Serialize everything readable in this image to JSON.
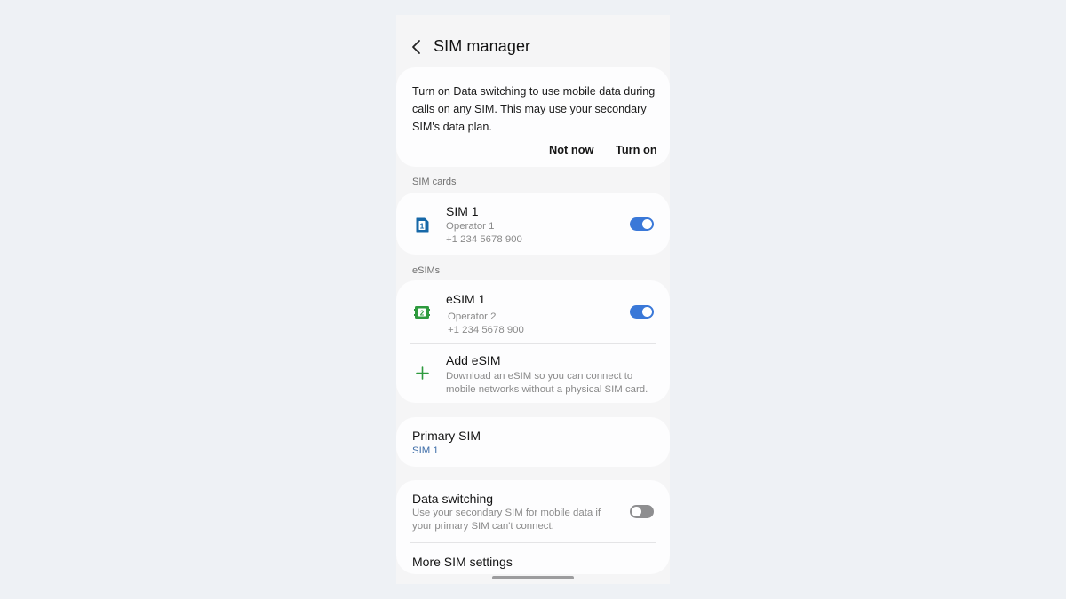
{
  "app": {
    "title": "SIM manager"
  },
  "notice": {
    "text": "Turn on Data switching to use mobile data during calls on any SIM. This may use your secondary SIM's data plan.",
    "not_now": "Not now",
    "turn_on": "Turn on"
  },
  "sim_cards": {
    "section_label": "SIM cards",
    "items": [
      {
        "title": "SIM 1",
        "operator": "Operator 1",
        "number": "+1 234 5678 900",
        "icon": "sim-card-1-icon",
        "icon_label": "1",
        "enabled": true,
        "icon_color": "#1668a8"
      }
    ]
  },
  "esims": {
    "section_label": "eSIMs",
    "items": [
      {
        "title": "eSIM 1",
        "operator": "Operator 2",
        "number": "+1 234 5678 900",
        "icon": "esim-2-icon",
        "icon_label": "2",
        "enabled": true,
        "icon_color": "#2e9a3e"
      }
    ],
    "add": {
      "title": "Add eSIM",
      "description": "Download an eSIM so you can connect to mobile networks without a physical SIM card.",
      "icon": "plus-icon"
    }
  },
  "primary_sim": {
    "title": "Primary SIM",
    "value": "SIM 1"
  },
  "data_switching": {
    "title": "Data switching",
    "description": "Use your secondary SIM for mobile data if your primary SIM can't connect.",
    "enabled": false
  },
  "more": {
    "title": "More SIM settings"
  },
  "colors": {
    "accent": "#3a78d8",
    "page_bg": "#eef1f5",
    "panel_bg": "#f5f5f6",
    "card_bg": "#fdfdfe"
  }
}
